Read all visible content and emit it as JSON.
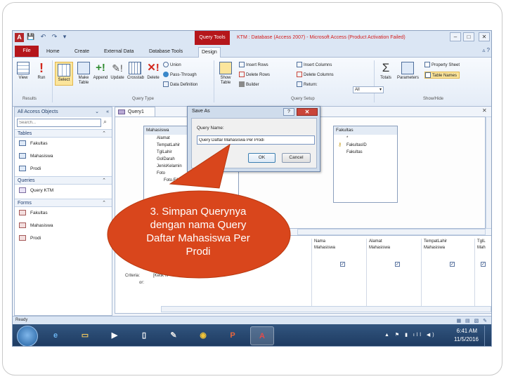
{
  "window": {
    "title": "KTM : Database (Access 2007) - Microsoft Access (Product Activation Failed)",
    "context_tab": "Query Tools",
    "quick_access_logo": "A",
    "minimize_icon": "minimize-icon",
    "maximize_icon": "maximize-icon",
    "close_icon": "close-icon"
  },
  "ribbon_tabs": [
    "File",
    "Home",
    "Create",
    "External Data",
    "Database Tools",
    "Design"
  ],
  "ribbon": {
    "results_buttons": [
      "View",
      "Run"
    ],
    "query_type_buttons": [
      "Select",
      "Make Table",
      "Append",
      "Update",
      "Crosstab",
      "Delete"
    ],
    "query_type_small": [
      "Union",
      "Pass-Through",
      "Data Definition"
    ],
    "show_table": "Show Table",
    "setup_small": [
      "Insert Rows",
      "Delete Rows",
      "Builder",
      "Insert Columns",
      "Delete Columns",
      "Return:"
    ],
    "return_value": "All",
    "totals": "Totals",
    "parameters": "Parameters",
    "showhide_small": [
      "Property Sheet",
      "Table Names"
    ],
    "group_labels": [
      "Results",
      "Query Type",
      "Query Setup",
      "Show/Hide"
    ]
  },
  "nav_pane": {
    "header": "All Access Objects",
    "search_placeholder": "Search...",
    "sections": [
      {
        "label": "Tables",
        "items": [
          "Fakultas",
          "Mahasiswa",
          "Prodi"
        ]
      },
      {
        "label": "Queries",
        "items": [
          "Query KTM"
        ]
      },
      {
        "label": "Forms",
        "items": [
          "Fakultas",
          "Mahasiswa",
          "Prodi"
        ]
      }
    ]
  },
  "query_tab": "Query1",
  "tables": {
    "mahasiswa": {
      "title": "Mahasiswa",
      "fields": [
        "Alamat",
        "TempatLahir",
        "TglLahir",
        "GolDarah",
        "JenisKelamin",
        "Foto",
        "Foto.FileData"
      ]
    },
    "fakultas": {
      "title": "Fakultas",
      "fields": [
        "*",
        "FakultasID",
        "Fakultas"
      ]
    }
  },
  "grid": {
    "row_labels": [
      "Field:",
      "Table:",
      "Sort:",
      "Show:",
      "Criteria:",
      "or:"
    ],
    "criteria_fragment": "[Ketik N",
    "columns": [
      {
        "field": "Nama",
        "table": "Mahasiswa"
      },
      {
        "field": "Alamat",
        "table": "Mahasiswa"
      },
      {
        "field": "TempatLahir",
        "table": "Mahasiswa"
      },
      {
        "field": "TglL",
        "table": "Mah"
      }
    ]
  },
  "dialog": {
    "title": "Save As",
    "label": "Query Name:",
    "value": "Query Daftar Mahasiswa Per Prodi",
    "ok": "OK",
    "cancel": "Cancel",
    "help": "?"
  },
  "status_bar": "Ready",
  "taskbar": {
    "apps": [
      "ie-icon",
      "explorer-icon",
      "media-icon",
      "file-icon",
      "paint-icon",
      "chrome-icon",
      "powerpoint-icon",
      "access-icon"
    ],
    "time": "6:41 AM",
    "date": "11/5/2016"
  },
  "callout": {
    "text": "3. Simpan Querynya dengan nama Query Daftar Mahasiswa Per Prodi",
    "color": "#d9461c"
  }
}
